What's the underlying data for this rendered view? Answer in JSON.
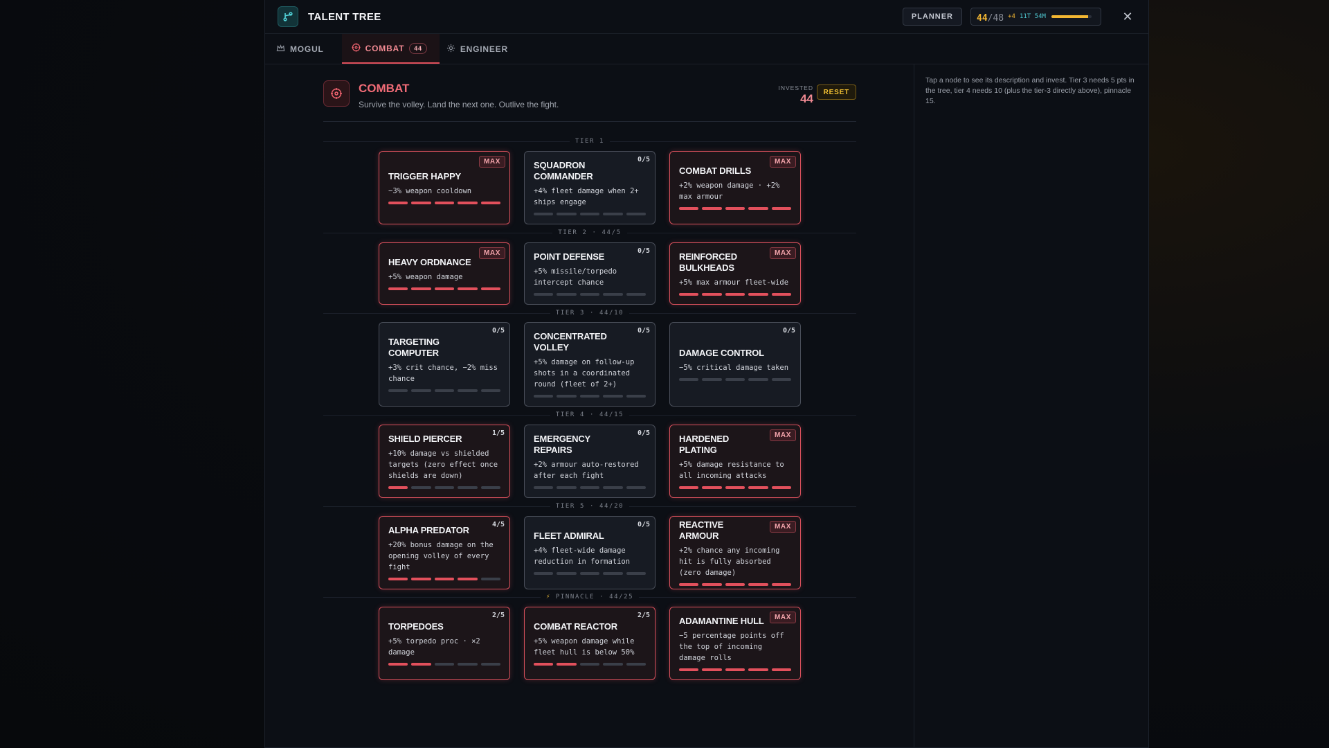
{
  "header": {
    "title": "TALENT TREE",
    "icon": "branch-icon",
    "planner_label": "PLANNER",
    "points_used": "44",
    "points_total": "/48",
    "points_extra": "+4",
    "points_timer": "11T 54M",
    "points_progress": 0.917,
    "accent": "#f2b632"
  },
  "tabs": [
    {
      "label": "MOGUL",
      "icon": "crown-icon"
    },
    {
      "label": "COMBAT",
      "icon": "crosshair-icon",
      "badge": "44",
      "active": true
    },
    {
      "label": "ENGINEER",
      "icon": "gear-icon"
    }
  ],
  "tree": {
    "name": "COMBAT",
    "subtitle": "Survive the volley. Land the next one. Outlive the fight.",
    "invested_label": "INVESTED",
    "invested_value": "44",
    "reset_label": "RESET",
    "accent": "#e2505c"
  },
  "side_help": "Tap a node to see its description and invest. Tier 3 needs 5 pts in the tree, tier 4 needs 10 (plus the tier-3 directly above), pinnacle 15.",
  "tiers": [
    {
      "label": "TIER 1",
      "nodes": [
        {
          "name": "TRIGGER HAPPY",
          "desc": "−3% weapon cooldown",
          "rank": 5,
          "max_rank": 5
        },
        {
          "name": "SQUADRON COMMANDER",
          "desc": "+4% fleet damage when 2+ ships engage",
          "rank": 0,
          "max_rank": 5
        },
        {
          "name": "COMBAT DRILLS",
          "desc": "+2% weapon damage · +2% max armour",
          "rank": 5,
          "max_rank": 5
        }
      ]
    },
    {
      "label": "TIER 2 · 44/5",
      "nodes": [
        {
          "name": "HEAVY ORDNANCE",
          "desc": "+5% weapon damage",
          "rank": 5,
          "max_rank": 5
        },
        {
          "name": "POINT DEFENSE",
          "desc": "+5% missile/torpedo intercept chance",
          "rank": 0,
          "max_rank": 5
        },
        {
          "name": "REINFORCED BULKHEADS",
          "desc": "+5% max armour fleet-wide",
          "rank": 5,
          "max_rank": 5
        }
      ]
    },
    {
      "label": "TIER 3 · 44/10",
      "nodes": [
        {
          "name": "TARGETING COMPUTER",
          "desc": "+3% crit chance, −2% miss chance",
          "rank": 0,
          "max_rank": 5
        },
        {
          "name": "CONCENTRATED VOLLEY",
          "desc": "+5% damage on follow-up shots in a coordinated round (fleet of 2+)",
          "rank": 0,
          "max_rank": 5
        },
        {
          "name": "DAMAGE CONTROL",
          "desc": "−5% critical damage taken",
          "rank": 0,
          "max_rank": 5
        }
      ]
    },
    {
      "label": "TIER 4 · 44/15",
      "nodes": [
        {
          "name": "SHIELD PIERCER",
          "desc": "+10% damage vs shielded targets (zero effect once shields are down)",
          "rank": 1,
          "max_rank": 5
        },
        {
          "name": "EMERGENCY REPAIRS",
          "desc": "+2% armour auto-restored after each fight",
          "rank": 0,
          "max_rank": 5
        },
        {
          "name": "HARDENED PLATING",
          "desc": "+5% damage resistance to all incoming attacks",
          "rank": 5,
          "max_rank": 5
        }
      ]
    },
    {
      "label": "TIER 5 · 44/20",
      "nodes": [
        {
          "name": "ALPHA PREDATOR",
          "desc": "+20% bonus damage on the opening volley of every fight",
          "rank": 4,
          "max_rank": 5
        },
        {
          "name": "FLEET ADMIRAL",
          "desc": "+4% fleet-wide damage reduction in formation",
          "rank": 0,
          "max_rank": 5
        },
        {
          "name": "REACTIVE ARMOUR",
          "desc": "+2% chance any incoming hit is fully absorbed (zero damage)",
          "rank": 5,
          "max_rank": 5
        }
      ]
    },
    {
      "label": "PINNACLE · 44/25",
      "pinnacle": true,
      "nodes": [
        {
          "name": "TORPEDOES",
          "desc": "+5% torpedo proc · ×2 damage",
          "rank": 2,
          "max_rank": 5
        },
        {
          "name": "COMBAT REACTOR",
          "desc": "+5% weapon damage while fleet hull is below 50%",
          "rank": 2,
          "max_rank": 5
        },
        {
          "name": "ADAMANTINE HULL",
          "desc": "−5 percentage points off the top of incoming damage rolls",
          "rank": 5,
          "max_rank": 5
        }
      ]
    }
  ],
  "max_label": "MAX"
}
